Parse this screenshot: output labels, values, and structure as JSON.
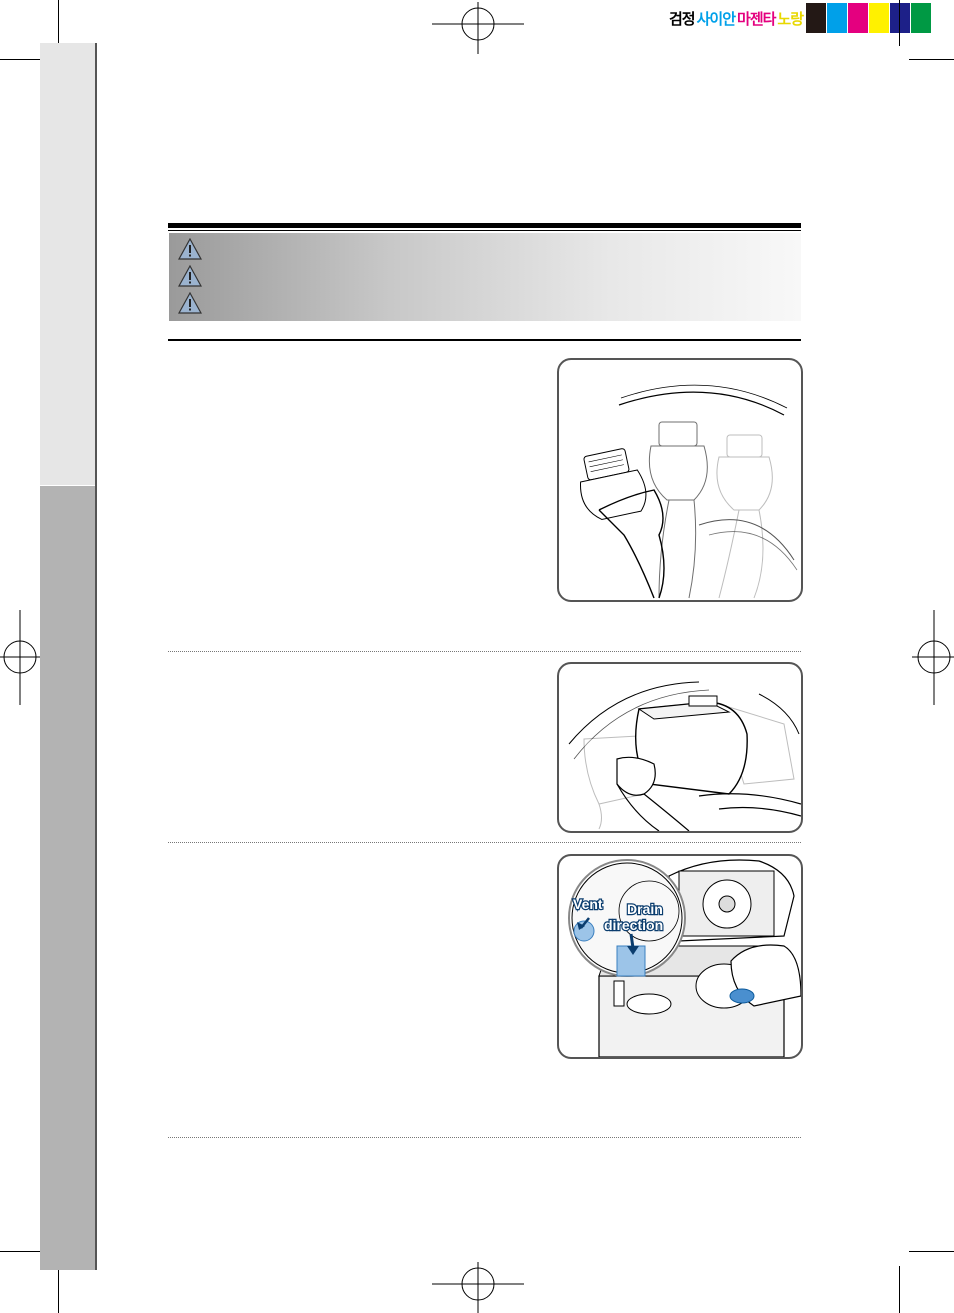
{
  "color_bar": {
    "labels": [
      "검정",
      "사이안",
      "마젠타",
      "노랑"
    ],
    "label_colors": [
      "#000000",
      "#00a0e9",
      "#e4007f",
      "#fff100"
    ],
    "swatches": [
      "#231815",
      "#00a0e9",
      "#e4007f",
      "#fff100",
      "#1d2088",
      "#009944"
    ]
  },
  "warnings": [
    {
      "icon": "warning-triangle-icon",
      "text": ""
    },
    {
      "icon": "warning-triangle-icon",
      "text": ""
    },
    {
      "icon": "warning-triangle-icon",
      "text": ""
    }
  ],
  "steps": [
    {
      "text": "",
      "illustration": "hand-removing-bottle"
    },
    {
      "text": "",
      "illustration": "hands-lifting-tank"
    },
    {
      "text": "",
      "illustration": "tank-drain-detail"
    }
  ],
  "callouts": {
    "vent": "Vent",
    "drain_line1": "Drain",
    "drain_line2": "direction"
  }
}
